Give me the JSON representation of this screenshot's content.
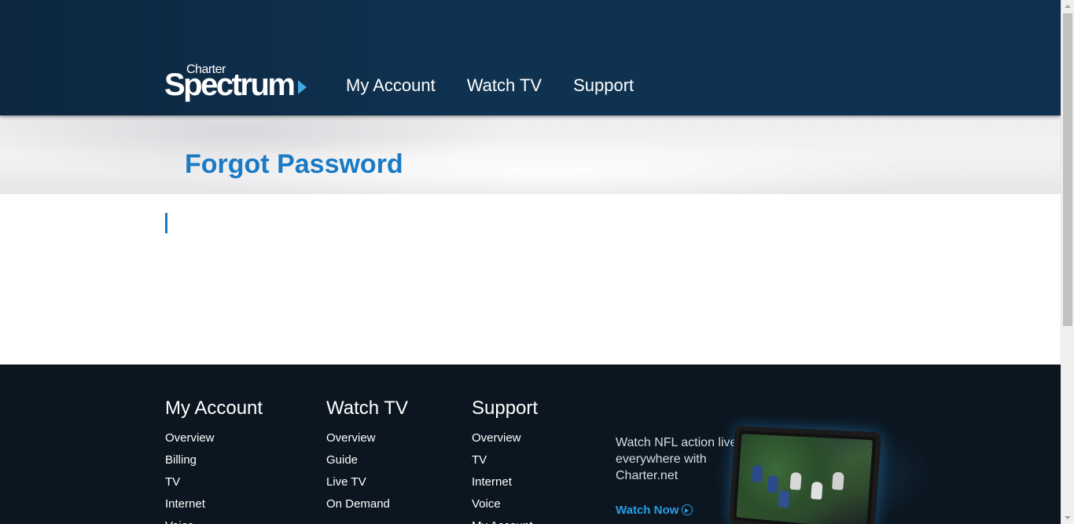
{
  "header": {
    "logo": {
      "small": "Charter",
      "big": "Spectrum"
    },
    "nav": [
      {
        "label": "My Account"
      },
      {
        "label": "Watch TV"
      },
      {
        "label": "Support"
      }
    ]
  },
  "page": {
    "title": "Forgot Password"
  },
  "footer": {
    "columns": [
      {
        "title": "My Account",
        "links": [
          "Overview",
          "Billing",
          "TV",
          "Internet",
          "Voice"
        ]
      },
      {
        "title": "Watch TV",
        "links": [
          "Overview",
          "Guide",
          "Live TV",
          "On Demand"
        ]
      },
      {
        "title": "Support",
        "links": [
          "Overview",
          "TV",
          "Internet",
          "Voice",
          "My Account"
        ]
      }
    ],
    "promo": {
      "text": "Watch NFL action live, everywhere with Charter.net",
      "link": "Watch Now"
    }
  },
  "colors": {
    "header_bg": "#0f3251",
    "title_blue": "#1a7ac4",
    "footer_bg": "#0b1620",
    "promo_link": "#2a9de0"
  }
}
